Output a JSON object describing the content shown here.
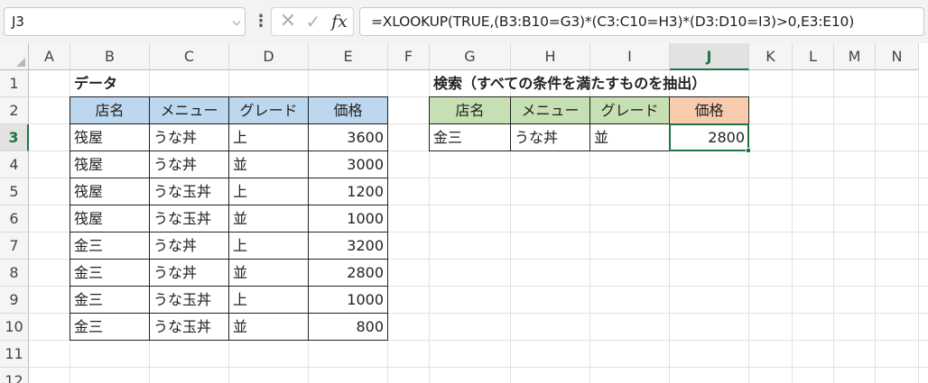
{
  "name_box": {
    "value": "J3",
    "arrow_icon": "chevron-down-icon"
  },
  "formula_bar": {
    "menu_icon": "vertical-dots-icon",
    "cancel_icon": "x-icon",
    "enter_icon": "check-icon",
    "fx_label": "fx",
    "formula": "=XLOOKUP(TRUE,(B3:B10=G3)*(C3:C10=H3)*(D3:D10=I3)>0,E3:E10)"
  },
  "columns": [
    "A",
    "B",
    "C",
    "D",
    "E",
    "F",
    "G",
    "H",
    "I",
    "J",
    "K",
    "L",
    "M",
    "N"
  ],
  "rows": [
    "1",
    "2",
    "3",
    "4",
    "5",
    "6",
    "7",
    "8",
    "9",
    "10",
    "11",
    "12"
  ],
  "active_cell": {
    "column": "J",
    "row": "3"
  },
  "data_table": {
    "title": "データ",
    "headers": [
      "店名",
      "メニュー",
      "グレード",
      "価格"
    ],
    "rows": [
      [
        "筏屋",
        "うな丼",
        "上",
        "3600"
      ],
      [
        "筏屋",
        "うな丼",
        "並",
        "3000"
      ],
      [
        "筏屋",
        "うな玉丼",
        "上",
        "1200"
      ],
      [
        "筏屋",
        "うな玉丼",
        "並",
        "1000"
      ],
      [
        "金三",
        "うな丼",
        "上",
        "3200"
      ],
      [
        "金三",
        "うな丼",
        "並",
        "2800"
      ],
      [
        "金三",
        "うな玉丼",
        "上",
        "1000"
      ],
      [
        "金三",
        "うな玉丼",
        "並",
        "800"
      ]
    ]
  },
  "search_table": {
    "title": "検索（すべての条件を満たすものを抽出）",
    "headers": [
      "店名",
      "メニュー",
      "グレード",
      "価格"
    ],
    "row": [
      "金三",
      "うな丼",
      "並",
      "2800"
    ]
  },
  "colors": {
    "data_header": "#bdd7ee",
    "search_header": "#c6e0b4",
    "result_header": "#f8cbad",
    "selection": "#217346"
  }
}
